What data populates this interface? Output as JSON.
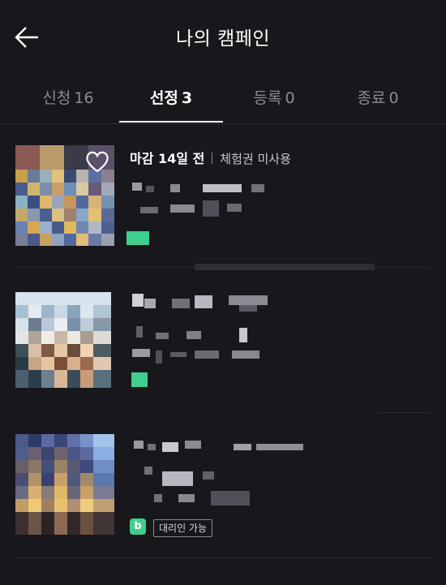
{
  "header": {
    "title": "나의 캠페인",
    "back_icon": "arrow-left-icon"
  },
  "tabs": [
    {
      "label": "신청",
      "count": "16",
      "active": false
    },
    {
      "label": "선정",
      "count": "3",
      "active": true
    },
    {
      "label": "등록",
      "count": "0",
      "active": false
    },
    {
      "label": "종료",
      "count": "0",
      "active": false
    }
  ],
  "campaigns": [
    {
      "deadline": "마감 14일 전",
      "voucher": "체험권 미사용",
      "favorite_icon": "heart-outline-icon"
    },
    {},
    {
      "badge": "b",
      "badge_color": "#3ecf8e",
      "proxy_label": "대리인 가능"
    }
  ],
  "colors": {
    "background": "#17171c",
    "accent": "#3ecf8e",
    "inactive_text": "#8a8a92"
  }
}
